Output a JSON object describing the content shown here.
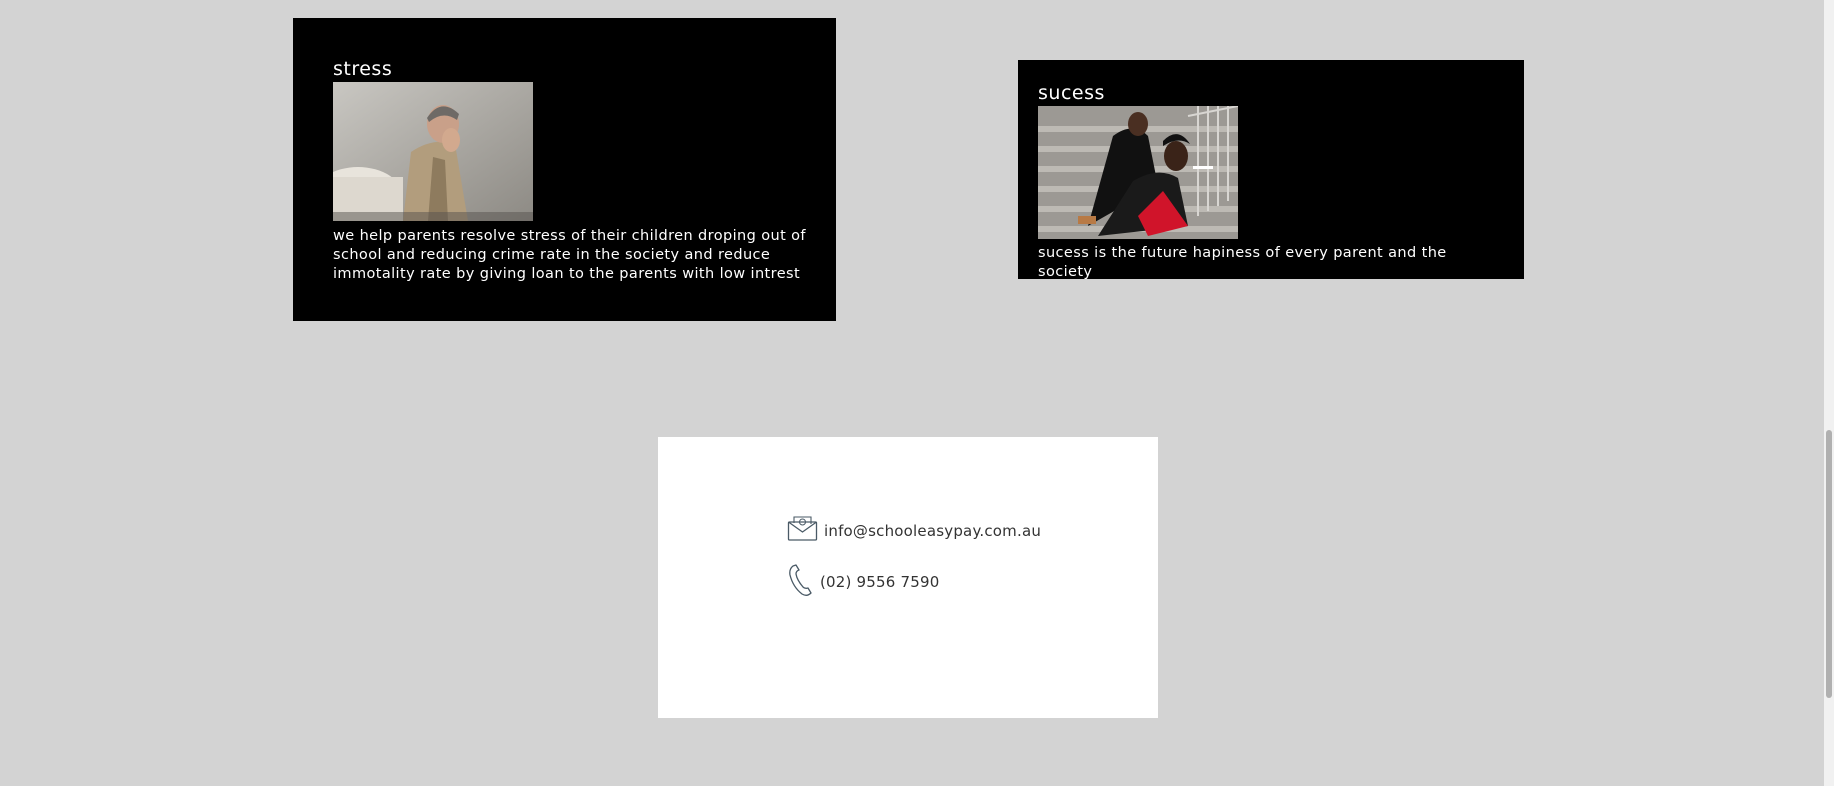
{
  "cards": {
    "stress": {
      "title": "stress",
      "text": "we help parents resolve stress of their children droping out of school and reducing crime rate in the society and reduce immotality rate by giving loan to the parents with low intrest"
    },
    "success": {
      "title": "sucess",
      "text": "sucess is the future hapiness of every parent and the society"
    }
  },
  "contact": {
    "email": "info@schooleasypay.com.au",
    "phone": "(02) 9556 7590",
    "email_icon": "envelope-icon",
    "phone_icon": "phone-icon"
  },
  "colors": {
    "background": "#d3d3d3",
    "card": "#000000",
    "card_text": "#ffffff",
    "contact_bg": "#ffffff"
  }
}
